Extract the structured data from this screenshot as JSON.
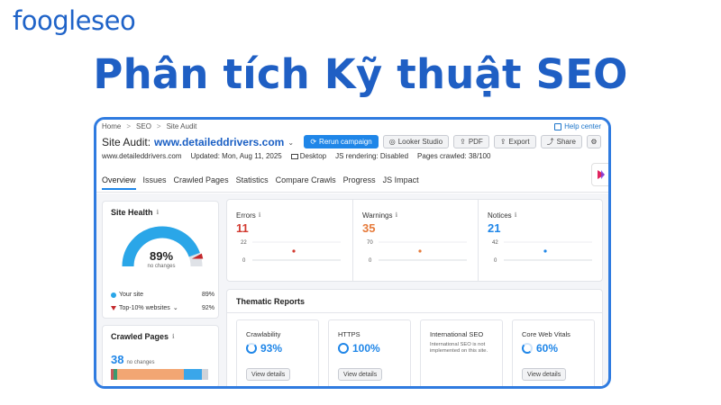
{
  "brand": {
    "logo_text": "foogleseo",
    "logo_part1": "foo",
    "logo_part2": "le",
    "logo_part3": "seo",
    "color": "#1f63c8"
  },
  "headline": "Phân tích Kỹ thuật SEO",
  "breadcrumb": [
    "Home",
    "SEO",
    "Site Audit"
  ],
  "help_label": "Help center",
  "audit": {
    "title_prefix": "Site Audit:",
    "domain": "www.detaileddrivers.com",
    "meta": {
      "site": "www.detaileddrivers.com",
      "updated": "Updated: Mon, Aug 11, 2025",
      "device": "Desktop",
      "js_rendering": "JS rendering: Disabled",
      "pages_crawled": "Pages crawled: 38/100"
    }
  },
  "actions": {
    "rerun": "Rerun campaign",
    "looker": "Looker Studio",
    "pdf": "PDF",
    "export": "Export",
    "share": "Share"
  },
  "tabs": [
    "Overview",
    "Issues",
    "Crawled Pages",
    "Statistics",
    "Compare Crawls",
    "Progress",
    "JS Impact"
  ],
  "site_health": {
    "title": "Site Health",
    "value": "89%",
    "value_fraction": 0.89,
    "sub": "no changes",
    "your_site_label": "Your site",
    "your_site_value": "89%",
    "top10_label": "Top-10% websites",
    "top10_value": "92%",
    "top10_fraction": 0.92
  },
  "crawled_pages": {
    "title": "Crawled Pages",
    "value": "38",
    "sub": "no changes",
    "segments": [
      {
        "fraction": 0.03,
        "color": "#c8585a"
      },
      {
        "fraction": 0.03,
        "color": "#3b9b6e"
      },
      {
        "fraction": 0.66,
        "color": "#f2a673"
      },
      {
        "fraction": 0.18,
        "color": "#3aa6ea"
      },
      {
        "fraction": 0.06,
        "color": "#d0d3d9"
      }
    ]
  },
  "issues": [
    {
      "label": "Errors",
      "value": "11",
      "color": "#d23a30",
      "ymax": "22",
      "ymin": "0",
      "dot_color": "#d23a30"
    },
    {
      "label": "Warnings",
      "value": "35",
      "color": "#e67a3a",
      "ymax": "70",
      "ymin": "0",
      "dot_color": "#e67a3a"
    },
    {
      "label": "Notices",
      "value": "21",
      "color": "#1f86e8",
      "ymax": "42",
      "ymin": "0",
      "dot_color": "#1f86e8"
    }
  ],
  "thematic": {
    "title": "Thematic Reports",
    "button": "View details",
    "cards": [
      {
        "name": "Crawlability",
        "value": "93%",
        "fraction": 0.93
      },
      {
        "name": "HTTPS",
        "value": "100%",
        "fraction": 1.0
      },
      {
        "name": "International SEO",
        "note": "International SEO is not implemented on this site."
      },
      {
        "name": "Core Web Vitals",
        "value": "60%",
        "fraction": 0.6
      }
    ]
  }
}
